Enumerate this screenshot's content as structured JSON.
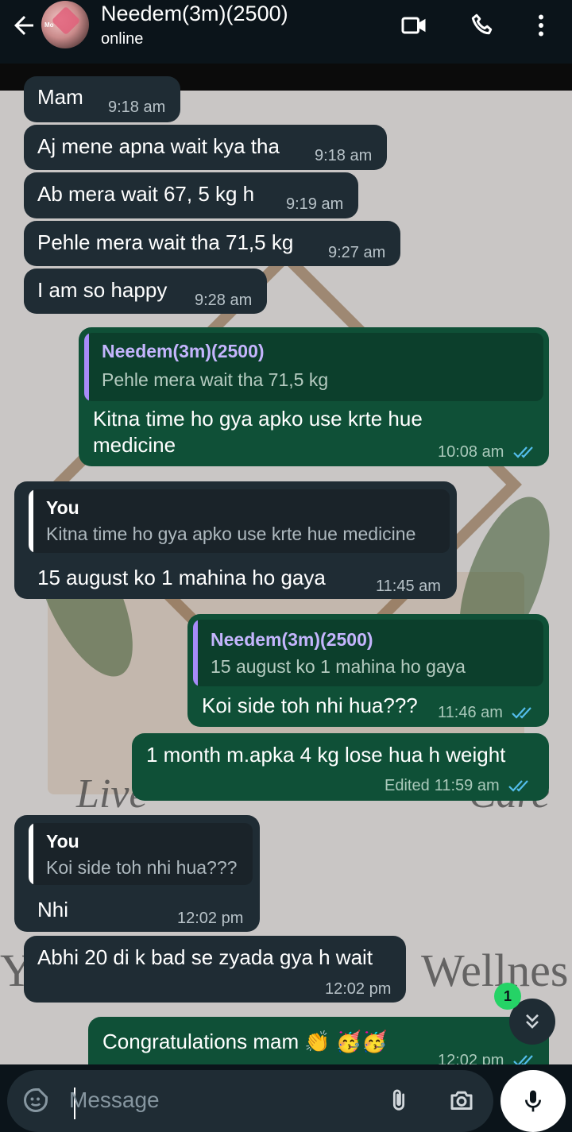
{
  "header": {
    "contact_name": "Needem(3m)(2500)",
    "status": "online",
    "avatar_text": "Mo",
    "icons": [
      "back-arrow-icon",
      "video-call-icon",
      "phone-call-icon",
      "more-options-icon"
    ]
  },
  "messages": [
    {
      "dir": "in",
      "text": "Mam",
      "time": "9:18 am"
    },
    {
      "dir": "in",
      "text": "Aj mene apna wait kya tha",
      "time": "9:18 am"
    },
    {
      "dir": "in",
      "text": "Ab mera wait 67, 5 kg h",
      "time": "9:19 am"
    },
    {
      "dir": "in",
      "text": "Pehle mera wait tha 71,5 kg",
      "time": "9:27 am"
    },
    {
      "dir": "in",
      "text": "I am so happy",
      "time": "9:28 am"
    },
    {
      "dir": "out",
      "quote_name": "Needem(3m)(2500)",
      "quote_text": "Pehle mera wait tha 71,5 kg",
      "text_line1": "Kitna time ho gya apko use krte hue",
      "text_line2": "medicine",
      "time": "10:08 am",
      "read": true
    },
    {
      "dir": "in",
      "quote_name": "You",
      "quote_text": "Kitna time ho gya apko use krte hue medicine",
      "text": "15 august ko 1 mahina ho gaya",
      "time": "11:45 am"
    },
    {
      "dir": "out",
      "quote_name": "Needem(3m)(2500)",
      "quote_text": "15 august ko 1 mahina ho gaya",
      "text": "Koi side toh nhi hua???",
      "time": "11:46 am",
      "read": true
    },
    {
      "dir": "out",
      "text": "1 month m.apka 4 kg lose hua h weight",
      "edited": "Edited",
      "time": "11:59 am",
      "read": true
    },
    {
      "dir": "in",
      "quote_name": "You",
      "quote_text": "Koi side toh nhi hua???",
      "text": "Nhi",
      "time": "12:02 pm"
    },
    {
      "dir": "in",
      "text": "Abhi 20 di k bad se zyada gya h wait",
      "time": "12:02 pm"
    },
    {
      "dir": "out",
      "text": "Congratulations mam 👏 🥳🥳",
      "time": "12:02 pm",
      "read": true
    }
  ],
  "scroll": {
    "unread_count": "1"
  },
  "composer": {
    "placeholder": "Message"
  },
  "wallpaper": {
    "text_left": "Live",
    "text_right": "Care",
    "text_bottom_left": "Y",
    "text_bottom_right": "Wellnes"
  },
  "colors": {
    "incoming": "#1f2c34",
    "outgoing": "#0f5037",
    "read_ticks": "#53bdeb",
    "accent": "#25d366"
  }
}
